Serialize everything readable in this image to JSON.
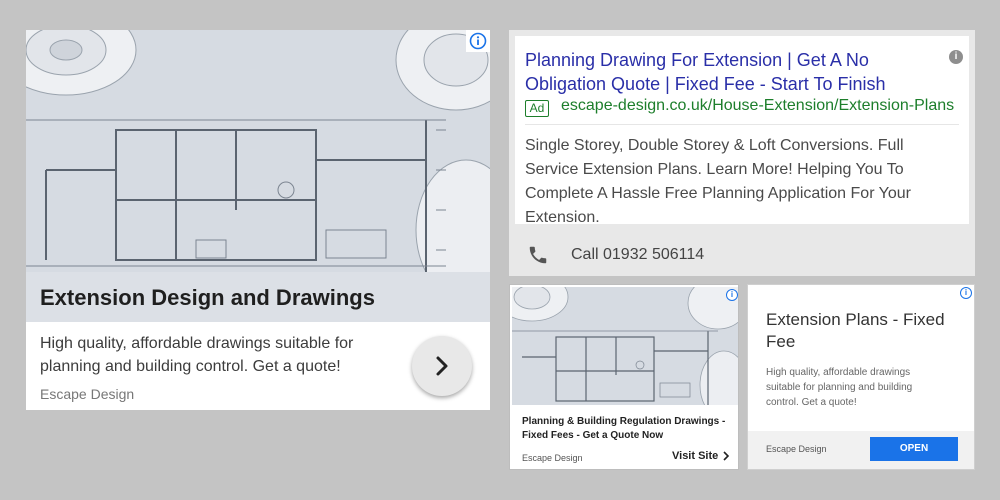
{
  "card1": {
    "headline": "Extension Design and Drawings",
    "description": "High quality, affordable drawings suitable for planning and building control. Get a quote!",
    "advertiser": "Escape Design",
    "info_glyph": "i",
    "arrow_icon": "chevron-right-icon"
  },
  "card2": {
    "title": "Planning Drawing For Extension | Get A No Obligation Quote | Fixed Fee - Start To Finish",
    "ad_badge": "Ad",
    "url": "escape-design.co.uk/House-Extension/Extension-Plans",
    "description": "Single Storey, Double Storey & Loft Conversions. Full Service Extension Plans. Learn More! Helping You To Complete A Hassle Free Planning Application For Your Extension.",
    "info_glyph": "i",
    "call_text": "Call 01932 506114",
    "call_icon": "phone-icon"
  },
  "card3": {
    "headline": "Planning & Building Regulation Drawings - Fixed Fees - Get a Quote Now",
    "advertiser": "Escape Design",
    "cta": "Visit Site",
    "info_glyph": "i"
  },
  "card4": {
    "headline": "Extension Plans - Fixed Fee",
    "description": "High quality, affordable drawings suitable for planning and building control. Get a quote!",
    "advertiser": "Escape Design",
    "cta": "OPEN",
    "info_glyph": "i"
  },
  "colors": {
    "link_blue": "#2a2fa8",
    "url_green": "#1d7e2b",
    "button_blue": "#1a73e8",
    "background": "#c4c4c4"
  }
}
